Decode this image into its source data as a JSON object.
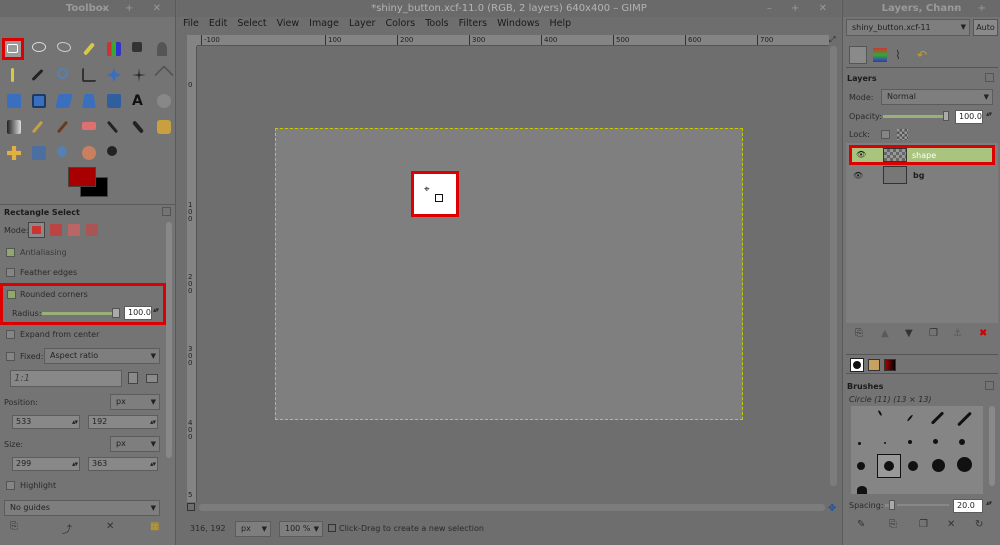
{
  "toolbox": {
    "title": "Toolbox",
    "window_controls": "– + ✕",
    "tool_options_title": "Rectangle Select",
    "mode_label": "Mode:",
    "antialiasing_label": "Antialiasing",
    "feather_label": "Feather edges",
    "rounded_label": "Rounded corners",
    "radius_label": "Radius:",
    "radius_value": "100.0",
    "expand_label": "Expand from center",
    "fixed_label": "Fixed:",
    "fixed_option": "Aspect ratio",
    "ratio_value": "1:1",
    "position_label": "Position:",
    "position_unit": "px",
    "pos_x": "533",
    "pos_y": "192",
    "size_label": "Size:",
    "size_unit": "px",
    "size_w": "299",
    "size_h": "363",
    "highlight_label": "Highlight",
    "guides_option": "No guides",
    "colors": {
      "fg": "#a80000",
      "bg": "#000000"
    }
  },
  "image_window": {
    "title": "*shiny_button.xcf-11.0 (RGB, 2 layers) 640x400 – GIMP",
    "window_controls": "– + ✕",
    "menus": [
      "File",
      "Edit",
      "Select",
      "View",
      "Image",
      "Layer",
      "Colors",
      "Tools",
      "Filters",
      "Windows",
      "Help"
    ],
    "ruler_ticks": [
      "-100",
      "100",
      "200",
      "300",
      "400",
      "500",
      "600",
      "700"
    ],
    "vruler_ticks": [
      "0",
      "1 0 0",
      "2 0 0",
      "3 0 0",
      "4 0 0",
      "5"
    ],
    "status": {
      "coords": "316, 192",
      "unit": "px",
      "zoom": "100 %",
      "message": "Click-Drag to create a new selection"
    }
  },
  "dock": {
    "title": "Layers, Chann",
    "window_controls": "– +",
    "image_selector": "shiny_button.xcf-11",
    "auto_label": "Auto",
    "layers_title": "Layers",
    "mode_label": "Mode:",
    "mode_value": "Normal",
    "opacity_label": "Opacity:",
    "opacity_value": "100.0",
    "lock_label": "Lock:",
    "layers": [
      {
        "name": "shape",
        "selected": true
      },
      {
        "name": "bg",
        "selected": false
      }
    ],
    "brushes_title": "Brushes",
    "brush_name": "Circle (11) (13 × 13)",
    "spacing_label": "Spacing:",
    "spacing_value": "20.0"
  },
  "accent": "#dd0000"
}
